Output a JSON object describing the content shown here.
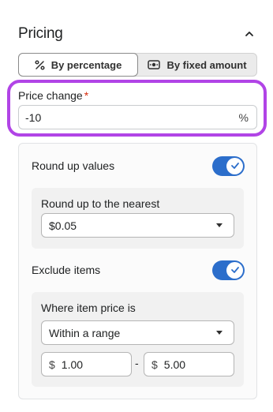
{
  "header": {
    "title": "Pricing"
  },
  "mode_tabs": [
    {
      "label": "By percentage",
      "icon": "percent-icon",
      "active": true
    },
    {
      "label": "By fixed amount",
      "icon": "cash-icon",
      "active": false
    }
  ],
  "price_change": {
    "label": "Price change",
    "required_mark": "*",
    "value": "-10",
    "suffix": "%"
  },
  "round_up": {
    "label": "Round up values",
    "enabled": true,
    "nearest_label": "Round up to the nearest",
    "nearest_value": "$0.05"
  },
  "exclude": {
    "label": "Exclude items",
    "enabled": true,
    "condition_label": "Where item price is",
    "condition_value": "Within a range",
    "currency_symbol": "$",
    "min": "1.00",
    "max": "5.00",
    "range_separator": "-"
  },
  "colors": {
    "accent": "#2c6ecb",
    "highlight": "#b144e6",
    "required": "#d72c0d"
  }
}
